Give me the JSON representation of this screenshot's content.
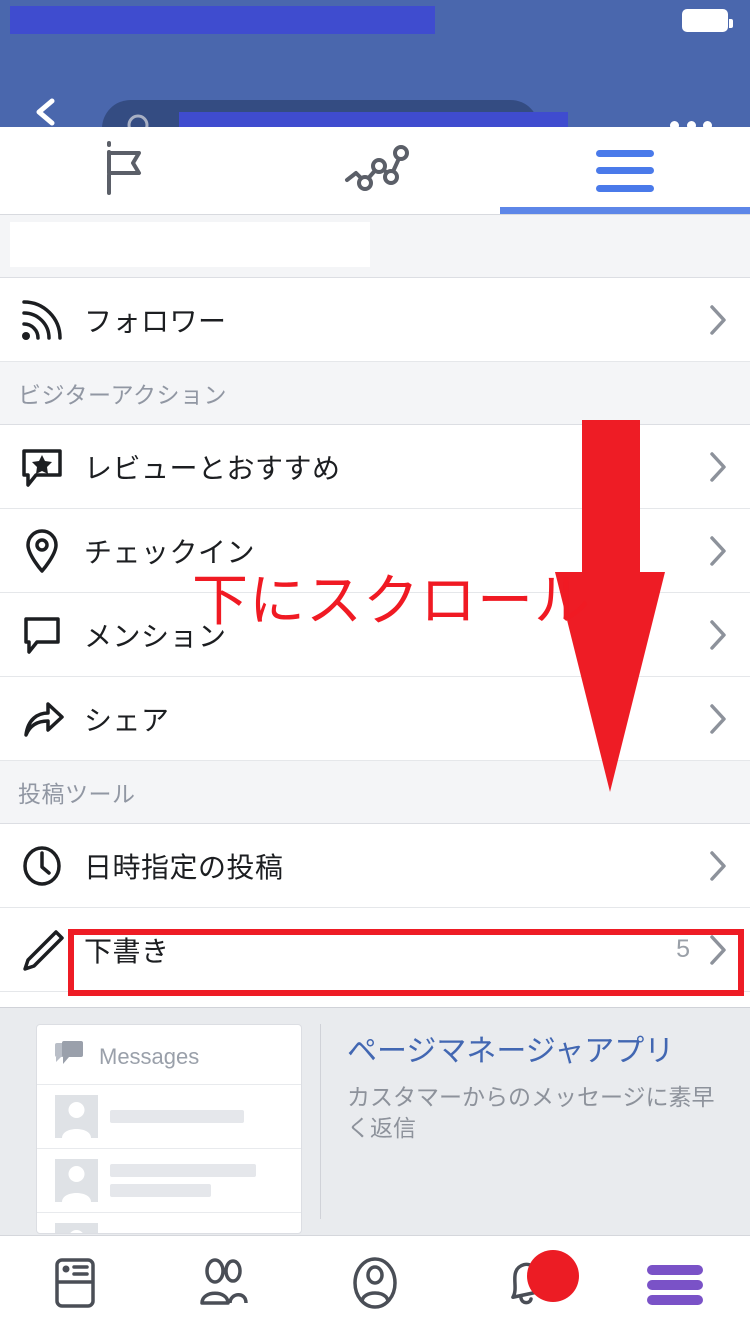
{
  "statusbar": {
    "redacted": true,
    "battery_icon": "battery-full-icon"
  },
  "topbar": {
    "back_icon": "back-chevron-icon",
    "search_icon": "search-icon",
    "search_value": "",
    "search_placeholder": "",
    "more_icon": "more-options-icon"
  },
  "tabs": [
    {
      "icon": "page-flag-icon",
      "name": "tab-page",
      "active": false
    },
    {
      "icon": "insights-chart-icon",
      "name": "tab-insights",
      "active": false
    },
    {
      "icon": "hamburger-menu-icon",
      "name": "tab-more",
      "active": true
    }
  ],
  "list": {
    "top_partial_row": {
      "label": "",
      "redacted": true
    },
    "rows_top": [
      {
        "icon": "rss-follower-icon",
        "label": "フォロワー",
        "count": "",
        "chevron": "chevron-right-icon"
      }
    ],
    "section_visitor": {
      "header": "ビジターアクション",
      "rows": [
        {
          "icon": "review-star-bubble-icon",
          "label": "レビューとおすすめ",
          "count": "",
          "chevron": "chevron-right-icon"
        },
        {
          "icon": "location-pin-icon",
          "label": "チェックイン",
          "count": "",
          "chevron": "chevron-right-icon"
        },
        {
          "icon": "comment-bubble-icon",
          "label": "メンション",
          "count": "",
          "chevron": "chevron-right-icon"
        },
        {
          "icon": "share-arrow-icon",
          "label": "シェア",
          "count": "",
          "chevron": "chevron-right-icon"
        }
      ]
    },
    "section_posting": {
      "header": "投稿ツール",
      "rows": [
        {
          "icon": "clock-icon",
          "label": "日時指定の投稿",
          "count": "",
          "chevron": "chevron-right-icon"
        },
        {
          "icon": "pencil-icon",
          "label": "下書き",
          "count": "5",
          "chevron": "chevron-right-icon",
          "highlighted": true
        }
      ]
    }
  },
  "promo": {
    "mock_title": "Messages",
    "mock_icon": "messages-bubbles-icon",
    "title": "ページマネージャアプリ",
    "subtitle": "カスタマーからのメッセージに素早く返信"
  },
  "bottomnav": [
    {
      "icon": "news-feed-icon",
      "name": "bottom-nav-news-feed",
      "badge": ""
    },
    {
      "icon": "friends-icon",
      "name": "bottom-nav-friends",
      "badge": ""
    },
    {
      "icon": "profile-icon",
      "name": "bottom-nav-profile",
      "badge": ""
    },
    {
      "icon": "notifications-bell-icon",
      "name": "bottom-nav-notifications",
      "badge": "dot"
    },
    {
      "icon": "hamburger-menu-icon",
      "name": "bottom-nav-menu",
      "badge": ""
    }
  ],
  "annotations": {
    "arrow": "red-down-arrow",
    "text": "下にスクロール",
    "highlight_box": "red-rectangle-on-drafts-row",
    "color": "#ee1c25"
  }
}
